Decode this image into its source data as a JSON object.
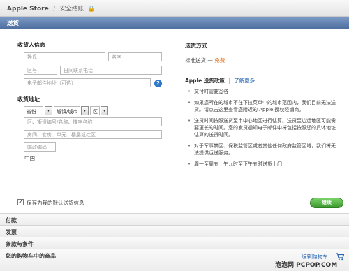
{
  "top_bar": {
    "store": "Apple Store",
    "separator": "/",
    "page": "安全结账",
    "lock": "🔒"
  },
  "section_title": "送货",
  "recipient": {
    "heading": "收货人信息",
    "last_name_placeholder": "姓氏",
    "first_name_placeholder": "名字",
    "area_code_placeholder": "区号",
    "phone_placeholder": "日间联系电话",
    "email_placeholder": "电子邮件地址（可选）",
    "help": "?"
  },
  "address": {
    "heading": "收货地址",
    "province": "省份",
    "city": "城镇/城市",
    "district": "区",
    "dropdown_arrow": "▾",
    "street_placeholder": "区、街道编号/名称、楼字名称",
    "unit_placeholder": "房间、套房、单元、楼层或社区",
    "postcode_placeholder": "邮政编码",
    "country": "中国"
  },
  "shipping": {
    "heading": "送货方式",
    "standard": "标准送货 — ",
    "free": "免费",
    "policy_title": "Apple 送货政策",
    "policy_sep": "|",
    "learn_more": "了解更多",
    "bullets": [
      "交付时需要签名",
      "如果您所在的城市不在下拉菜单中的城市范围内，我们目前无法送货。请点击这里查看您附近的 Apple 授权经销商。",
      "送货时间按照送货至市中心地区进行估算。送货至边远地区可能需要更长的时间。您的发货通知电子邮件中将包括按照您的具体地址估算的送货时间。",
      "对于军事禁区、保税监管区或者其他任何政府监管区域，我们将无法提供运送服务。",
      "周一至周五上午九时至下午五时送货上门"
    ]
  },
  "save_default": {
    "checked": "✓",
    "label": "保存为我的默认送货信息"
  },
  "continue_label": "继续",
  "collapsed_sections": [
    "付款",
    "发票",
    "条款与条件",
    "您的购物车中的商品"
  ],
  "edit_cart": "编辑购物车",
  "watermark": "泡泡网 PCPOP.COM"
}
